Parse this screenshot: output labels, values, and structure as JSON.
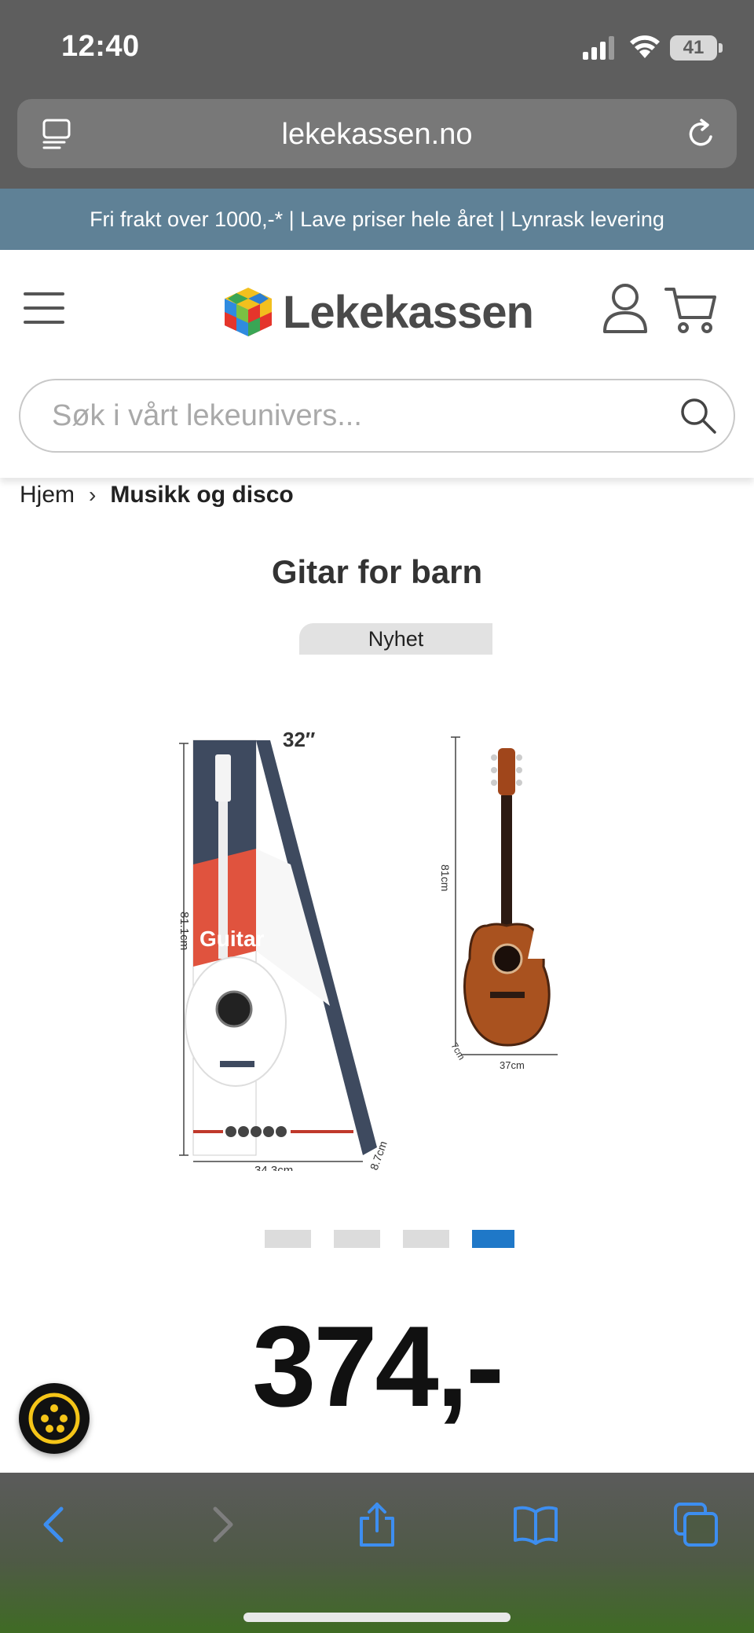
{
  "status_bar": {
    "time": "12:40",
    "battery": "41"
  },
  "browser": {
    "url": "lekekassen.no"
  },
  "promo_banner": {
    "text": "Fri frakt over 1000,-* | Lave priser hele året | Lynrask levering"
  },
  "header": {
    "brand": "Lekekassen",
    "search_placeholder": "Søk i vårt lekeunivers..."
  },
  "breadcrumb": {
    "home": "Hjem",
    "separator": "›",
    "current": "Musikk og disco"
  },
  "product": {
    "title": "Gitar for barn",
    "badge": "Nyhet",
    "price": "374,-",
    "image_labels": {
      "box_size": "32″",
      "box_height": "81.1cm",
      "box_width": "34.3cm",
      "box_depth": "8.7cm",
      "box_logo": "Guitar",
      "guitar_height": "81cm",
      "guitar_width": "37cm",
      "guitar_depth": "7cm"
    },
    "gallery_total": 4,
    "gallery_active_index": 3
  },
  "colors": {
    "promo_bg": "#5f8196",
    "accent_blue": "#1f78c8",
    "browser_chrome": "#5e5e5e",
    "cookie_yellow": "#f5c518"
  },
  "toolbar_icons": [
    "back-icon",
    "forward-icon",
    "share-icon",
    "bookmarks-icon",
    "tabs-icon"
  ]
}
